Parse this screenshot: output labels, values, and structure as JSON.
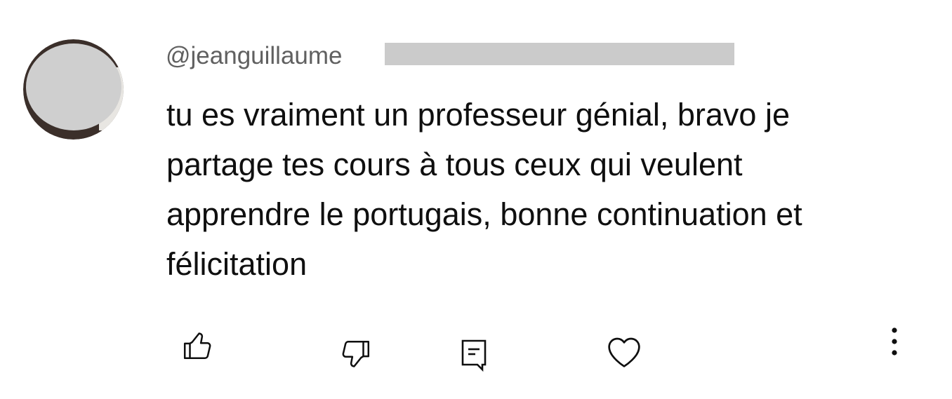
{
  "comment": {
    "author": "@jeanguillaume",
    "meta_redacted": "",
    "text_lines": [
      "tu es vraiment un professeur génial, bravo je",
      "partage tes cours à tous ceux qui veulent",
      "apprendre le portugais, bonne continuation et",
      "félicitation"
    ]
  },
  "actions": {
    "like_icon": "thumb-up-icon",
    "dislike_icon": "thumb-down-icon",
    "reply_icon": "comment-reply-icon",
    "heart_icon": "heart-icon",
    "more_icon": "more-vertical-icon"
  },
  "colors": {
    "text": "#0f0f0f",
    "secondary": "#606060",
    "redaction": "#cbcbcb"
  }
}
